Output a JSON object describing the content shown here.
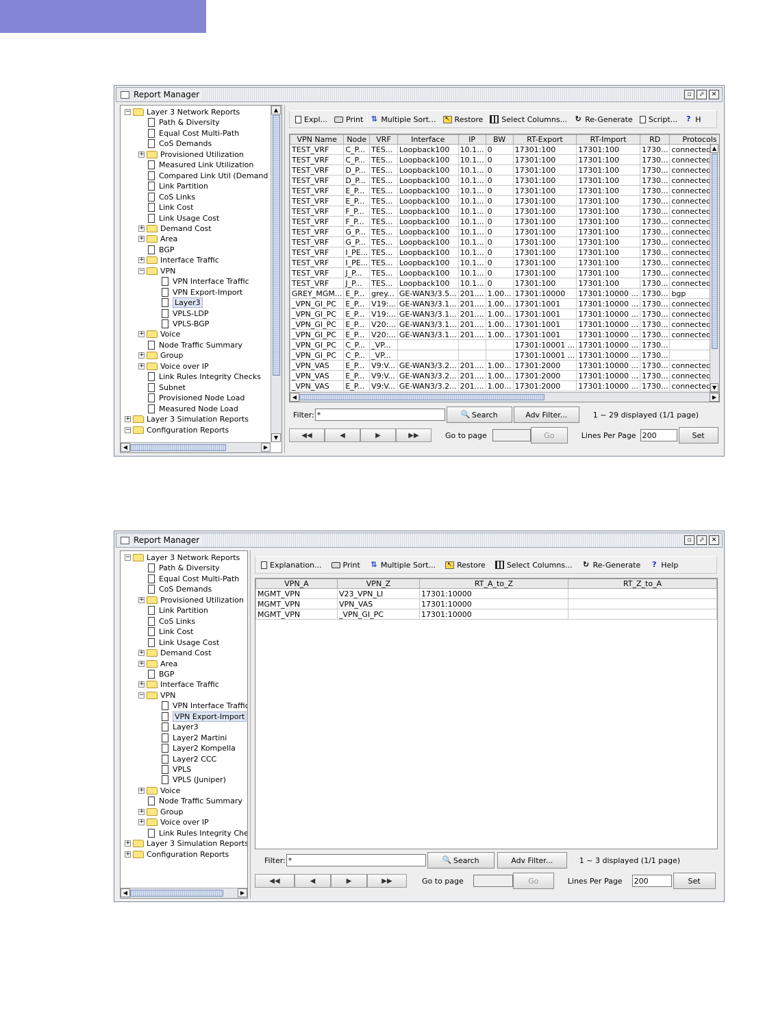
{
  "window1": {
    "title": "Report Manager",
    "tree": [
      {
        "exp": "−",
        "icon": "folder",
        "label": "Layer 3 Network Reports",
        "indent": 0
      },
      {
        "exp": "",
        "icon": "doc",
        "label": "Path & Diversity",
        "indent": 1
      },
      {
        "exp": "",
        "icon": "doc",
        "label": "Equal Cost Multi-Path",
        "indent": 1
      },
      {
        "exp": "",
        "icon": "doc",
        "label": "CoS Demands",
        "indent": 1
      },
      {
        "exp": "+",
        "icon": "folder",
        "label": "Provisioned Utilization",
        "indent": 1
      },
      {
        "exp": "",
        "icon": "doc",
        "label": "Measured Link Utilization",
        "indent": 1
      },
      {
        "exp": "",
        "icon": "doc",
        "label": "Compared Link Util (Demand",
        "indent": 1
      },
      {
        "exp": "",
        "icon": "doc",
        "label": "Link Partition",
        "indent": 1
      },
      {
        "exp": "",
        "icon": "doc",
        "label": "CoS Links",
        "indent": 1
      },
      {
        "exp": "",
        "icon": "doc",
        "label": "Link Cost",
        "indent": 1
      },
      {
        "exp": "",
        "icon": "doc",
        "label": "Link Usage Cost",
        "indent": 1
      },
      {
        "exp": "+",
        "icon": "folder",
        "label": "Demand Cost",
        "indent": 1
      },
      {
        "exp": "+",
        "icon": "folder",
        "label": "Area",
        "indent": 1
      },
      {
        "exp": "",
        "icon": "doc",
        "label": "BGP",
        "indent": 1
      },
      {
        "exp": "+",
        "icon": "folder",
        "label": "Interface Traffic",
        "indent": 1
      },
      {
        "exp": "−",
        "icon": "folder",
        "label": "VPN",
        "indent": 1
      },
      {
        "exp": "",
        "icon": "doc",
        "label": "VPN Interface Traffic",
        "indent": 2
      },
      {
        "exp": "",
        "icon": "doc",
        "label": "VPN Export-Import",
        "indent": 2
      },
      {
        "exp": "",
        "icon": "doc",
        "label": "Layer3",
        "indent": 2,
        "selected": true
      },
      {
        "exp": "",
        "icon": "doc",
        "label": "VPLS-LDP",
        "indent": 2
      },
      {
        "exp": "",
        "icon": "doc",
        "label": "VPLS-BGP",
        "indent": 2
      },
      {
        "exp": "+",
        "icon": "folder",
        "label": "Voice",
        "indent": 1
      },
      {
        "exp": "",
        "icon": "doc",
        "label": "Node Traffic Summary",
        "indent": 1
      },
      {
        "exp": "+",
        "icon": "folder",
        "label": "Group",
        "indent": 1
      },
      {
        "exp": "+",
        "icon": "folder",
        "label": "Voice over IP",
        "indent": 1
      },
      {
        "exp": "",
        "icon": "doc",
        "label": "Link Rules Integrity Checks",
        "indent": 1
      },
      {
        "exp": "",
        "icon": "doc",
        "label": "Subnet",
        "indent": 1
      },
      {
        "exp": "",
        "icon": "doc",
        "label": "Provisioned Node Load",
        "indent": 1
      },
      {
        "exp": "",
        "icon": "doc",
        "label": "Measured Node Load",
        "indent": 1
      },
      {
        "exp": "+",
        "icon": "folder",
        "label": "Layer 3 Simulation Reports",
        "indent": 0
      },
      {
        "exp": "−",
        "icon": "folder",
        "label": "Configuration Reports",
        "indent": 0
      }
    ],
    "toolbar": [
      "Expl...",
      "Print",
      "Multiple Sort...",
      "Restore",
      "Select Columns...",
      "Re-Generate",
      "Script...",
      "H"
    ],
    "columns": [
      "VPN Name",
      "Node",
      "VRF",
      "Interface",
      "IP",
      "BW",
      "RT-Export",
      "RT-Import",
      "RD",
      "Protocols"
    ],
    "rows": [
      [
        "TEST_VRF",
        "C_P...",
        "TES...",
        "Loopback100",
        "10.1...",
        "0",
        "17301:100",
        "17301:100",
        "1730...",
        "connected"
      ],
      [
        "TEST_VRF",
        "C_P...",
        "TES...",
        "Loopback100",
        "10.1...",
        "0",
        "17301:100",
        "17301:100",
        "1730...",
        "connected"
      ],
      [
        "TEST_VRF",
        "D_P...",
        "TES...",
        "Loopback100",
        "10.1...",
        "0",
        "17301:100",
        "17301:100",
        "1730...",
        "connected"
      ],
      [
        "TEST_VRF",
        "D_P...",
        "TES...",
        "Loopback100",
        "10.1...",
        "0",
        "17301:100",
        "17301:100",
        "1730...",
        "connected"
      ],
      [
        "TEST_VRF",
        "E_P...",
        "TES...",
        "Loopback100",
        "10.1...",
        "0",
        "17301:100",
        "17301:100",
        "1730...",
        "connected"
      ],
      [
        "TEST_VRF",
        "E_P...",
        "TES...",
        "Loopback100",
        "10.1...",
        "0",
        "17301:100",
        "17301:100",
        "1730...",
        "connected"
      ],
      [
        "TEST_VRF",
        "F_P...",
        "TES...",
        "Loopback100",
        "10.1...",
        "0",
        "17301:100",
        "17301:100",
        "1730...",
        "connected"
      ],
      [
        "TEST_VRF",
        "F_P...",
        "TES...",
        "Loopback100",
        "10.1...",
        "0",
        "17301:100",
        "17301:100",
        "1730...",
        "connected"
      ],
      [
        "TEST_VRF",
        "G_P...",
        "TES...",
        "Loopback100",
        "10.1...",
        "0",
        "17301:100",
        "17301:100",
        "1730...",
        "connected"
      ],
      [
        "TEST_VRF",
        "G_P...",
        "TES...",
        "Loopback100",
        "10.1...",
        "0",
        "17301:100",
        "17301:100",
        "1730...",
        "connected"
      ],
      [
        "TEST_VRF",
        "I_PE...",
        "TES...",
        "Loopback100",
        "10.1...",
        "0",
        "17301:100",
        "17301:100",
        "1730...",
        "connected"
      ],
      [
        "TEST_VRF",
        "I_PE...",
        "TES...",
        "Loopback100",
        "10.1...",
        "0",
        "17301:100",
        "17301:100",
        "1730...",
        "connected"
      ],
      [
        "TEST_VRF",
        "J_P...",
        "TES...",
        "Loopback100",
        "10.1...",
        "0",
        "17301:100",
        "17301:100",
        "1730...",
        "connected"
      ],
      [
        "TEST_VRF",
        "J_P...",
        "TES...",
        "Loopback100",
        "10.1...",
        "0",
        "17301:100",
        "17301:100",
        "1730...",
        "connected"
      ],
      [
        "GREY_MGM...",
        "E_P...",
        "grey...",
        "GE-WAN3/3.5...",
        "201....",
        "1.00...",
        "17301:10000",
        "17301:10000 ...",
        "1730...",
        "bgp"
      ],
      [
        "_VPN_GI_PC",
        "E_P...",
        "V19:...",
        "GE-WAN3/3.1...",
        "201....",
        "1.00...",
        "17301:1001",
        "17301:10000 ...",
        "1730...",
        "connected"
      ],
      [
        "_VPN_GI_PC",
        "E_P...",
        "V19:...",
        "GE-WAN3/3.1...",
        "201....",
        "1.00...",
        "17301:1001",
        "17301:10000 ...",
        "1730...",
        "connected bgp"
      ],
      [
        "_VPN_GI_PC",
        "E_P...",
        "V20:...",
        "GE-WAN3/3.1...",
        "201....",
        "1.00...",
        "17301:1001",
        "17301:10000 ...",
        "1730...",
        "connected"
      ],
      [
        "_VPN_GI_PC",
        "E_P...",
        "V20:...",
        "GE-WAN3/3.1...",
        "201....",
        "1.00...",
        "17301:1001",
        "17301:10000 ...",
        "1730...",
        "connected bgp"
      ],
      [
        "_VPN_GI_PC",
        "C_P...",
        "_VP...",
        "",
        "",
        "",
        "17301:10001 ...",
        "17301:10000 ...",
        "1730...",
        ""
      ],
      [
        "_VPN_GI_PC",
        "C_P...",
        "_VP...",
        "",
        "",
        "",
        "17301:10001 ...",
        "17301:10000 ...",
        "1730...",
        ""
      ],
      [
        "_VPN_VAS",
        "E_P...",
        "V9:V...",
        "GE-WAN3/3.2...",
        "201....",
        "1.00...",
        "17301:2000",
        "17301:10000 ...",
        "1730...",
        "connected"
      ],
      [
        "_VPN_VAS",
        "E_P...",
        "V9:V...",
        "GE-WAN3/3.2...",
        "201....",
        "1.00...",
        "17301:2000",
        "17301:10000 ...",
        "1730...",
        "connected"
      ],
      [
        "_VPN_VAS",
        "E_P...",
        "V9:V...",
        "GE-WAN3/3.2...",
        "201....",
        "1.00...",
        "17301:2000",
        "17301:10000 ...",
        "1730...",
        "connected bgp"
      ]
    ],
    "filter_label": "Filter:",
    "filter_value": "*",
    "search_label": "Search",
    "adv_filter_label": "Adv Filter...",
    "displayed": "1 ~ 29 displayed (1/1 page)",
    "goto_label": "Go to page",
    "go_label": "Go",
    "lines_label": "Lines Per Page",
    "lines_value": "200",
    "set_label": "Set"
  },
  "window2": {
    "title": "Report Manager",
    "tree": [
      {
        "exp": "−",
        "icon": "folder",
        "label": "Layer 3 Network Reports",
        "indent": 0
      },
      {
        "exp": "",
        "icon": "doc",
        "label": "Path & Diversity",
        "indent": 1
      },
      {
        "exp": "",
        "icon": "doc",
        "label": "Equal Cost Multi-Path",
        "indent": 1
      },
      {
        "exp": "",
        "icon": "doc",
        "label": "CoS Demands",
        "indent": 1
      },
      {
        "exp": "+",
        "icon": "folder",
        "label": "Provisioned Utilization",
        "indent": 1
      },
      {
        "exp": "",
        "icon": "doc",
        "label": "Link Partition",
        "indent": 1
      },
      {
        "exp": "",
        "icon": "doc",
        "label": "CoS Links",
        "indent": 1
      },
      {
        "exp": "",
        "icon": "doc",
        "label": "Link Cost",
        "indent": 1
      },
      {
        "exp": "",
        "icon": "doc",
        "label": "Link Usage Cost",
        "indent": 1
      },
      {
        "exp": "+",
        "icon": "folder",
        "label": "Demand Cost",
        "indent": 1
      },
      {
        "exp": "+",
        "icon": "folder",
        "label": "Area",
        "indent": 1
      },
      {
        "exp": "",
        "icon": "doc",
        "label": "BGP",
        "indent": 1
      },
      {
        "exp": "+",
        "icon": "folder",
        "label": "Interface Traffic",
        "indent": 1
      },
      {
        "exp": "−",
        "icon": "folder",
        "label": "VPN",
        "indent": 1
      },
      {
        "exp": "",
        "icon": "doc",
        "label": "VPN Interface Traffic",
        "indent": 2
      },
      {
        "exp": "",
        "icon": "doc",
        "label": "VPN Export-Import",
        "indent": 2,
        "selected": true
      },
      {
        "exp": "",
        "icon": "doc",
        "label": "Layer3",
        "indent": 2
      },
      {
        "exp": "",
        "icon": "doc",
        "label": "Layer2 Martini",
        "indent": 2
      },
      {
        "exp": "",
        "icon": "doc",
        "label": "Layer2 Kompella",
        "indent": 2
      },
      {
        "exp": "",
        "icon": "doc",
        "label": "Layer2 CCC",
        "indent": 2
      },
      {
        "exp": "",
        "icon": "doc",
        "label": "VPLS",
        "indent": 2
      },
      {
        "exp": "",
        "icon": "doc",
        "label": "VPLS (Juniper)",
        "indent": 2
      },
      {
        "exp": "+",
        "icon": "folder",
        "label": "Voice",
        "indent": 1
      },
      {
        "exp": "",
        "icon": "doc",
        "label": "Node Traffic Summary",
        "indent": 1
      },
      {
        "exp": "+",
        "icon": "folder",
        "label": "Group",
        "indent": 1
      },
      {
        "exp": "+",
        "icon": "folder",
        "label": "Voice over IP",
        "indent": 1
      },
      {
        "exp": "",
        "icon": "doc",
        "label": "Link Rules Integrity Che",
        "indent": 1
      },
      {
        "exp": "+",
        "icon": "folder",
        "label": "Layer 3 Simulation Reports",
        "indent": 0
      },
      {
        "exp": "+",
        "icon": "folder",
        "label": "Configuration Reports",
        "indent": 0
      }
    ],
    "toolbar": [
      "Explanation...",
      "Print",
      "Multiple Sort...",
      "Restore",
      "Select Columns...",
      "Re-Generate",
      "Help"
    ],
    "columns": [
      "VPN_A",
      "VPN_Z",
      "RT_A_to_Z",
      "RT_Z_to_A"
    ],
    "rows": [
      [
        "MGMT_VPN",
        "V23_VPN_LI",
        "17301:10000",
        ""
      ],
      [
        "MGMT_VPN",
        "VPN_VAS",
        "17301:10000",
        ""
      ],
      [
        "MGMT_VPN",
        "_VPN_GI_PC",
        "17301:10000",
        ""
      ]
    ],
    "filter_label": "Filter:",
    "filter_value": "*",
    "search_label": "Search",
    "adv_filter_label": "Adv Filter...",
    "displayed": "1 ~ 3 displayed (1/1 page)",
    "goto_label": "Go to page",
    "go_label": "Go",
    "lines_label": "Lines Per Page",
    "lines_value": "200",
    "set_label": "Set"
  },
  "icons": {
    "toolbar1": [
      "explanation-icon",
      "print-icon",
      "multiple-sort-icon",
      "restore-icon",
      "select-columns-icon",
      "regenerate-icon",
      "script-icon",
      "help-icon"
    ],
    "toolbar2": [
      "explanation-icon",
      "print-icon",
      "multiple-sort-icon",
      "restore-icon",
      "select-columns-icon",
      "regenerate-icon",
      "help-icon"
    ]
  },
  "colors": {
    "header_band": "#8585d5",
    "selection": "#dfe6f5"
  }
}
